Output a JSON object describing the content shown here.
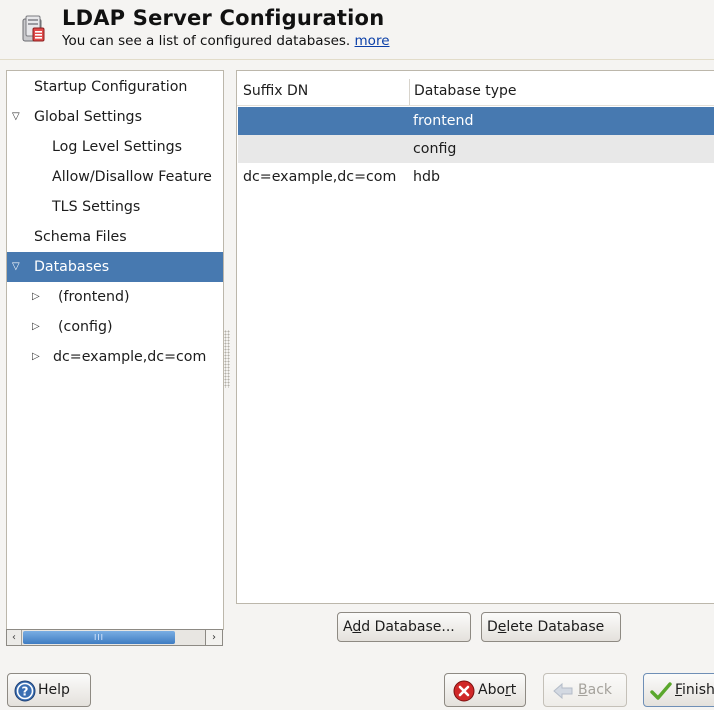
{
  "header": {
    "title": "LDAP Server Configuration",
    "subtitle": "You can see a list of configured databases.",
    "more_link": "more",
    "icon": "ldap-server-icon"
  },
  "tree": {
    "items": [
      {
        "label": "Startup Configuration"
      },
      {
        "label": "Global Settings",
        "expander": "expanded"
      },
      {
        "label": "Log Level Settings"
      },
      {
        "label": "Allow/Disallow Feature"
      },
      {
        "label": "TLS Settings"
      },
      {
        "label": "Schema Files"
      },
      {
        "label": "Databases",
        "expander": "expanded",
        "selected": true
      },
      {
        "label": "(frontend)",
        "expander": "collapsed"
      },
      {
        "label": "(config)",
        "expander": "collapsed"
      },
      {
        "label": "dc=example,dc=com",
        "expander": "collapsed"
      }
    ],
    "scrollbar_thumb_grip": "III"
  },
  "table": {
    "headers": [
      "Suffix DN",
      "Database type"
    ],
    "rows": [
      {
        "suffix": "",
        "type": "frontend",
        "selected": true
      },
      {
        "suffix": "",
        "type": "config"
      },
      {
        "suffix": "dc=example,dc=com",
        "type": "hdb"
      }
    ]
  },
  "buttons": {
    "add_database": {
      "pre": "A",
      "mnemonic": "d",
      "post": "d Database..."
    },
    "delete_database": {
      "pre": "D",
      "mnemonic": "e",
      "post": "lete Database"
    },
    "help": "Help",
    "abort": {
      "pre": "Abo",
      "mnemonic": "r",
      "post": "t"
    },
    "back": {
      "pre": "",
      "mnemonic": "B",
      "post": "ack",
      "disabled": true
    },
    "finish": {
      "pre": "",
      "mnemonic": "F",
      "post": "inish"
    }
  },
  "colors": {
    "selection": "#4779b0",
    "link": "#0a3fa8",
    "alt_row": "#e8e8e8"
  }
}
